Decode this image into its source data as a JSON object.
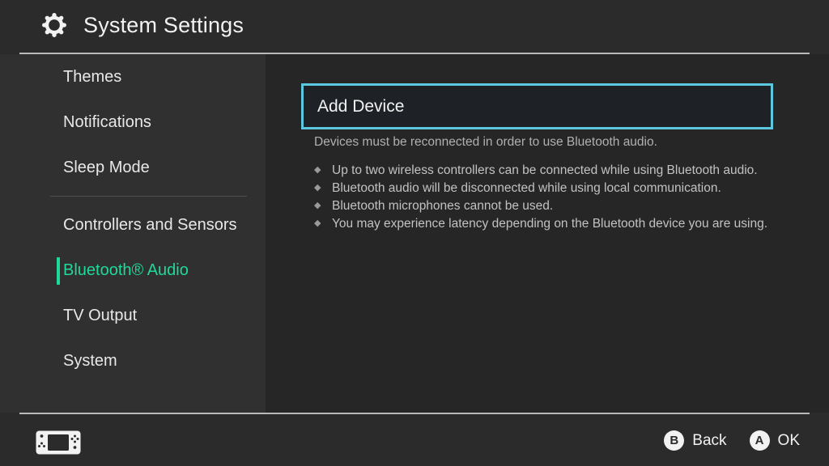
{
  "header": {
    "title": "System Settings",
    "gear_icon": "gear-icon"
  },
  "sidebar": {
    "groups": [
      {
        "items": [
          {
            "label": "Themes",
            "selected": false
          },
          {
            "label": "Notifications",
            "selected": false
          },
          {
            "label": "Sleep Mode",
            "selected": false
          }
        ]
      },
      {
        "items": [
          {
            "label": "Controllers and Sensors",
            "selected": false
          },
          {
            "label": "Bluetooth® Audio",
            "selected": true
          },
          {
            "label": "TV Output",
            "selected": false
          },
          {
            "label": "System",
            "selected": false
          }
        ]
      }
    ],
    "selected_color": "#1fd99b"
  },
  "main": {
    "add_device_label": "Add Device",
    "add_device_border_color": "#5cc8e0",
    "notice": "Devices must be reconnected in order to use Bluetooth audio.",
    "bullet_marker": "◆",
    "bullets": [
      "Up to two wireless controllers can be connected while using Bluetooth audio.",
      "Bluetooth audio will be disconnected while using local communication.",
      "Bluetooth microphones cannot be used.",
      "You may experience latency depending on the Bluetooth device you are using."
    ]
  },
  "footer": {
    "console_icon": "switch-console-icon",
    "actions": [
      {
        "button": "B",
        "label": "Back"
      },
      {
        "button": "A",
        "label": "OK"
      }
    ]
  }
}
